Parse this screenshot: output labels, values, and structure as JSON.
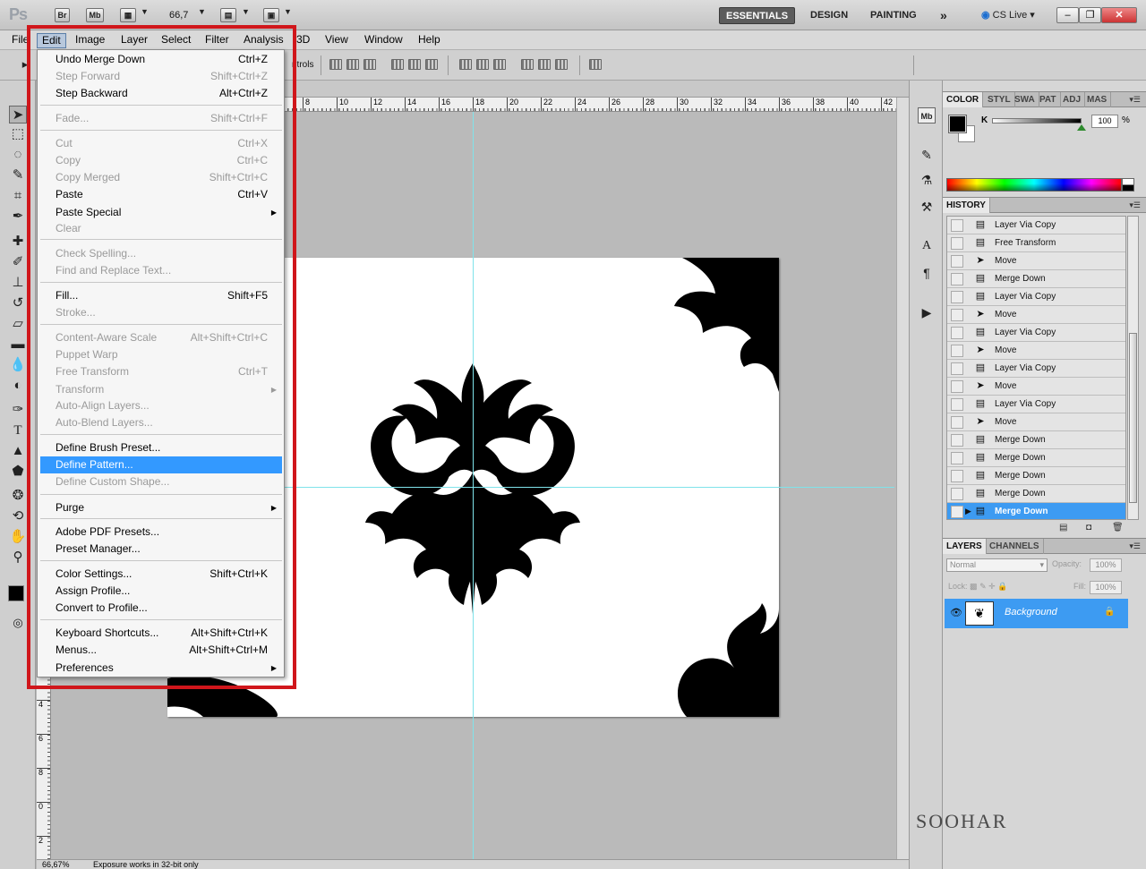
{
  "app": {
    "logo": "Ps",
    "bridge_btn": "Br",
    "minibridge_btn": "Mb",
    "zoom": "66,7",
    "workspaces": [
      "ESSENTIALS",
      "DESIGN",
      "PAINTING"
    ],
    "workspace_more": "»",
    "cslive": "CS Live",
    "window_controls": [
      "–",
      "❐",
      "✕"
    ]
  },
  "menubar": [
    "File",
    "Edit",
    "Image",
    "Layer",
    "Select",
    "Filter",
    "Analysis",
    "3D",
    "View",
    "Window",
    "Help"
  ],
  "optionsbar": {
    "partial_label": "ntrols"
  },
  "ruler": {
    "h_labels": [
      "8",
      "10",
      "12",
      "14",
      "16",
      "18",
      "20",
      "22",
      "24",
      "26",
      "28",
      "30",
      "32",
      "34",
      "36",
      "38",
      "40",
      "42"
    ],
    "v_labels": [
      "4",
      "6",
      "8",
      "0",
      "2",
      "4"
    ]
  },
  "statusbar": {
    "zoom": "66,67%",
    "message": "Exposure works in 32-bit only"
  },
  "edit_menu": {
    "items": [
      {
        "label": "Undo Merge Down",
        "shortcut": "Ctrl+Z",
        "disabled": false
      },
      {
        "label": "Step Forward",
        "shortcut": "Shift+Ctrl+Z",
        "disabled": true
      },
      {
        "label": "Step Backward",
        "shortcut": "Alt+Ctrl+Z",
        "disabled": false
      },
      {
        "label": "Fade...",
        "shortcut": "Shift+Ctrl+F",
        "disabled": true
      },
      {
        "label": "Cut",
        "shortcut": "Ctrl+X",
        "disabled": true
      },
      {
        "label": "Copy",
        "shortcut": "Ctrl+C",
        "disabled": true
      },
      {
        "label": "Copy Merged",
        "shortcut": "Shift+Ctrl+C",
        "disabled": true
      },
      {
        "label": "Paste",
        "shortcut": "Ctrl+V",
        "disabled": false
      },
      {
        "label": "Paste Special",
        "shortcut": "",
        "disabled": false,
        "submenu": true
      },
      {
        "label": "Clear",
        "shortcut": "",
        "disabled": true
      },
      {
        "label": "Check Spelling...",
        "shortcut": "",
        "disabled": true
      },
      {
        "label": "Find and Replace Text...",
        "shortcut": "",
        "disabled": true
      },
      {
        "label": "Fill...",
        "shortcut": "Shift+F5",
        "disabled": false
      },
      {
        "label": "Stroke...",
        "shortcut": "",
        "disabled": true
      },
      {
        "label": "Content-Aware Scale",
        "shortcut": "Alt+Shift+Ctrl+C",
        "disabled": true
      },
      {
        "label": "Puppet Warp",
        "shortcut": "",
        "disabled": true
      },
      {
        "label": "Free Transform",
        "shortcut": "Ctrl+T",
        "disabled": true
      },
      {
        "label": "Transform",
        "shortcut": "",
        "disabled": true,
        "submenu": true
      },
      {
        "label": "Auto-Align Layers...",
        "shortcut": "",
        "disabled": true
      },
      {
        "label": "Auto-Blend Layers...",
        "shortcut": "",
        "disabled": true
      },
      {
        "label": "Define Brush Preset...",
        "shortcut": "",
        "disabled": false
      },
      {
        "label": "Define Pattern...",
        "shortcut": "",
        "disabled": false,
        "highlighted": true
      },
      {
        "label": "Define Custom Shape...",
        "shortcut": "",
        "disabled": true
      },
      {
        "label": "Purge",
        "shortcut": "",
        "disabled": false,
        "submenu": true
      },
      {
        "label": "Adobe PDF Presets...",
        "shortcut": "",
        "disabled": false
      },
      {
        "label": "Preset Manager...",
        "shortcut": "",
        "disabled": false
      },
      {
        "label": "Color Settings...",
        "shortcut": "Shift+Ctrl+K",
        "disabled": false
      },
      {
        "label": "Assign Profile...",
        "shortcut": "",
        "disabled": false
      },
      {
        "label": "Convert to Profile...",
        "shortcut": "",
        "disabled": false
      },
      {
        "label": "Keyboard Shortcuts...",
        "shortcut": "Alt+Shift+Ctrl+K",
        "disabled": false
      },
      {
        "label": "Menus...",
        "shortcut": "Alt+Shift+Ctrl+M",
        "disabled": false
      },
      {
        "label": "Preferences",
        "shortcut": "",
        "disabled": false,
        "submenu": true
      }
    ]
  },
  "color_panel": {
    "tabs": [
      "COLOR",
      "STYL",
      "SWA",
      "PAT",
      "ADJ",
      "MAS"
    ],
    "channel": "K",
    "value": "100",
    "unit": "%",
    "k_level": 1.0
  },
  "history_panel": {
    "tab": "HISTORY",
    "items": [
      {
        "label": "Layer Via Copy",
        "icon": "doc-icon"
      },
      {
        "label": "Free Transform",
        "icon": "doc-icon"
      },
      {
        "label": "Move",
        "icon": "move-icon"
      },
      {
        "label": "Merge Down",
        "icon": "doc-icon"
      },
      {
        "label": "Layer Via Copy",
        "icon": "doc-icon"
      },
      {
        "label": "Move",
        "icon": "move-icon"
      },
      {
        "label": "Layer Via Copy",
        "icon": "doc-icon"
      },
      {
        "label": "Move",
        "icon": "move-icon"
      },
      {
        "label": "Layer Via Copy",
        "icon": "doc-icon"
      },
      {
        "label": "Move",
        "icon": "move-icon"
      },
      {
        "label": "Layer Via Copy",
        "icon": "doc-icon"
      },
      {
        "label": "Move",
        "icon": "move-icon"
      },
      {
        "label": "Merge Down",
        "icon": "doc-icon"
      },
      {
        "label": "Merge Down",
        "icon": "doc-icon"
      },
      {
        "label": "Merge Down",
        "icon": "doc-icon"
      },
      {
        "label": "Merge Down",
        "icon": "doc-icon"
      },
      {
        "label": "Merge Down",
        "icon": "doc-icon",
        "selected": true
      }
    ]
  },
  "layers_panel": {
    "tabs": [
      "LAYERS",
      "CHANNELS"
    ],
    "blend_mode": "Normal",
    "opacity_label": "Opacity:",
    "opacity": "100%",
    "lock_label": "Lock:",
    "fill_label": "Fill:",
    "fill": "100%",
    "layer_name": "Background"
  },
  "watermark": "SOOHAR",
  "colors": {
    "highlight": "#3399ff",
    "selection_blue": "#3d9bf2",
    "red_outline": "#d0161b",
    "guide": "#7fe3ea"
  }
}
